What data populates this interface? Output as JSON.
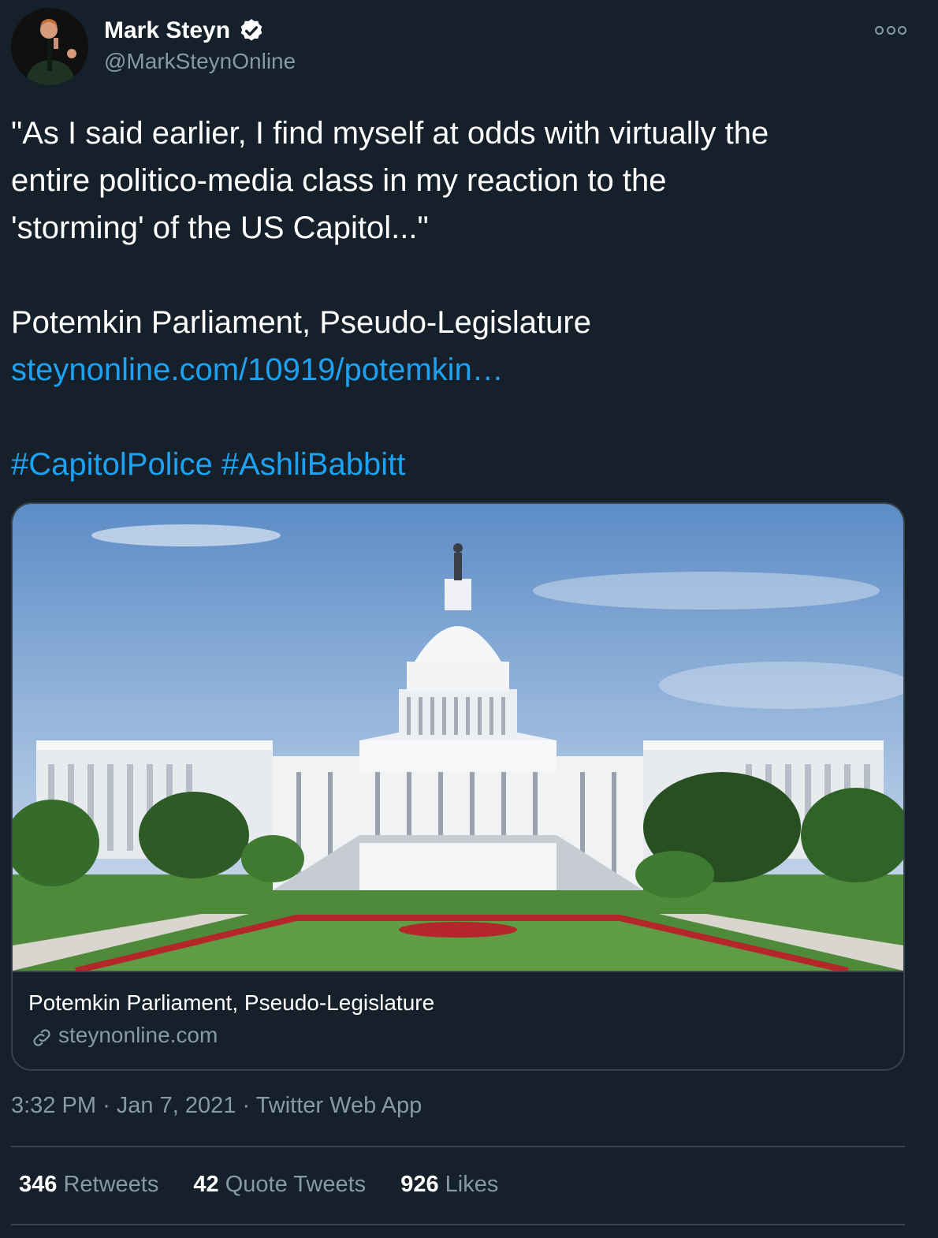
{
  "author": {
    "name": "Mark Steyn",
    "handle": "@MarkSteynOnline",
    "verified": true
  },
  "tweet": {
    "lines": [
      "\"As I said earlier, I find myself at odds with virtually the",
      "entire politico-media class in my reaction to the",
      "'storming' of the US Capitol...\"",
      "Potemkin Parliament, Pseudo-Legislature"
    ],
    "link_text": "steynonline.com/10919/potemkin…",
    "hashtags": [
      "#CapitolPolice",
      "#AshliBabbitt"
    ]
  },
  "card": {
    "image_alt": "US Capitol building",
    "title": "Potemkin Parliament, Pseudo-Legislature",
    "domain": "steynonline.com"
  },
  "meta": {
    "time": "3:32 PM",
    "separator": "·",
    "date": "Jan 7, 2021",
    "source": "Twitter Web App"
  },
  "stats": {
    "retweets": {
      "count": "346",
      "label": "Retweets"
    },
    "quote_tweets": {
      "count": "42",
      "label": "Quote Tweets"
    },
    "likes": {
      "count": "926",
      "label": "Likes"
    }
  },
  "colors": {
    "background": "#15202b",
    "link": "#1da1f2",
    "secondary_text": "#8899a6",
    "border": "#38444d"
  },
  "icons": [
    "verified-badge-icon",
    "more-options-icon",
    "link-icon"
  ]
}
